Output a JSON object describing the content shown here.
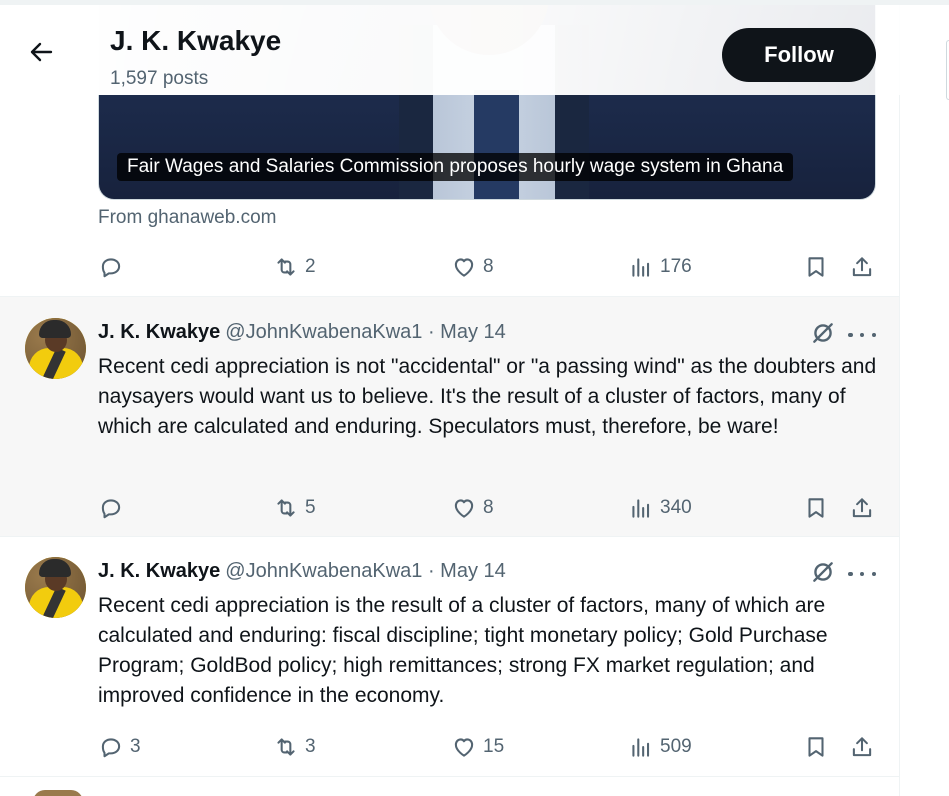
{
  "header": {
    "name": "J. K. Kwakye",
    "posts": "1,597 posts",
    "follow_label": "Follow"
  },
  "top_tweet": {
    "card_caption": "Fair Wages and Salaries Commission proposes hourly wage system in Ghana",
    "card_source": "From ghanaweb.com",
    "replies": "",
    "reposts": "2",
    "likes": "8",
    "views": "176"
  },
  "tweets": [
    {
      "name": "J. K. Kwakye",
      "handle": "@JohnKwabenaKwa1 · May 14",
      "text": "Recent cedi appreciation is not \"accidental\" or \"a passing wind\" as the doubters and naysayers would want us to believe. It's the result of a cluster of factors, many of which are calculated and enduring. Speculators must, therefore, be ware!",
      "replies": "",
      "reposts": "5",
      "likes": "8",
      "views": "340"
    },
    {
      "name": "J. K. Kwakye",
      "handle": "@JohnKwabenaKwa1 · May 14",
      "text": "Recent cedi appreciation is the result of a cluster of factors, many of which are calculated and enduring: fiscal discipline; tight monetary policy; Gold Purchase Program; GoldBod policy; high remittances; strong FX market regulation; and improved confidence in the economy.",
      "replies": "3",
      "reposts": "3",
      "likes": "15",
      "views": "509"
    }
  ],
  "icons": {
    "back": "arrow-left-icon",
    "reply": "reply-icon",
    "repost": "repost-icon",
    "like": "heart-icon",
    "views": "views-chart-icon",
    "bookmark": "bookmark-icon",
    "share": "share-icon",
    "grok": "grok-icon",
    "more": "more-icon"
  },
  "colors": {
    "text": "#0f1419",
    "secondary": "#536471",
    "follow_bg": "#0f1419",
    "highlight_bg": "#f7f7f7"
  }
}
